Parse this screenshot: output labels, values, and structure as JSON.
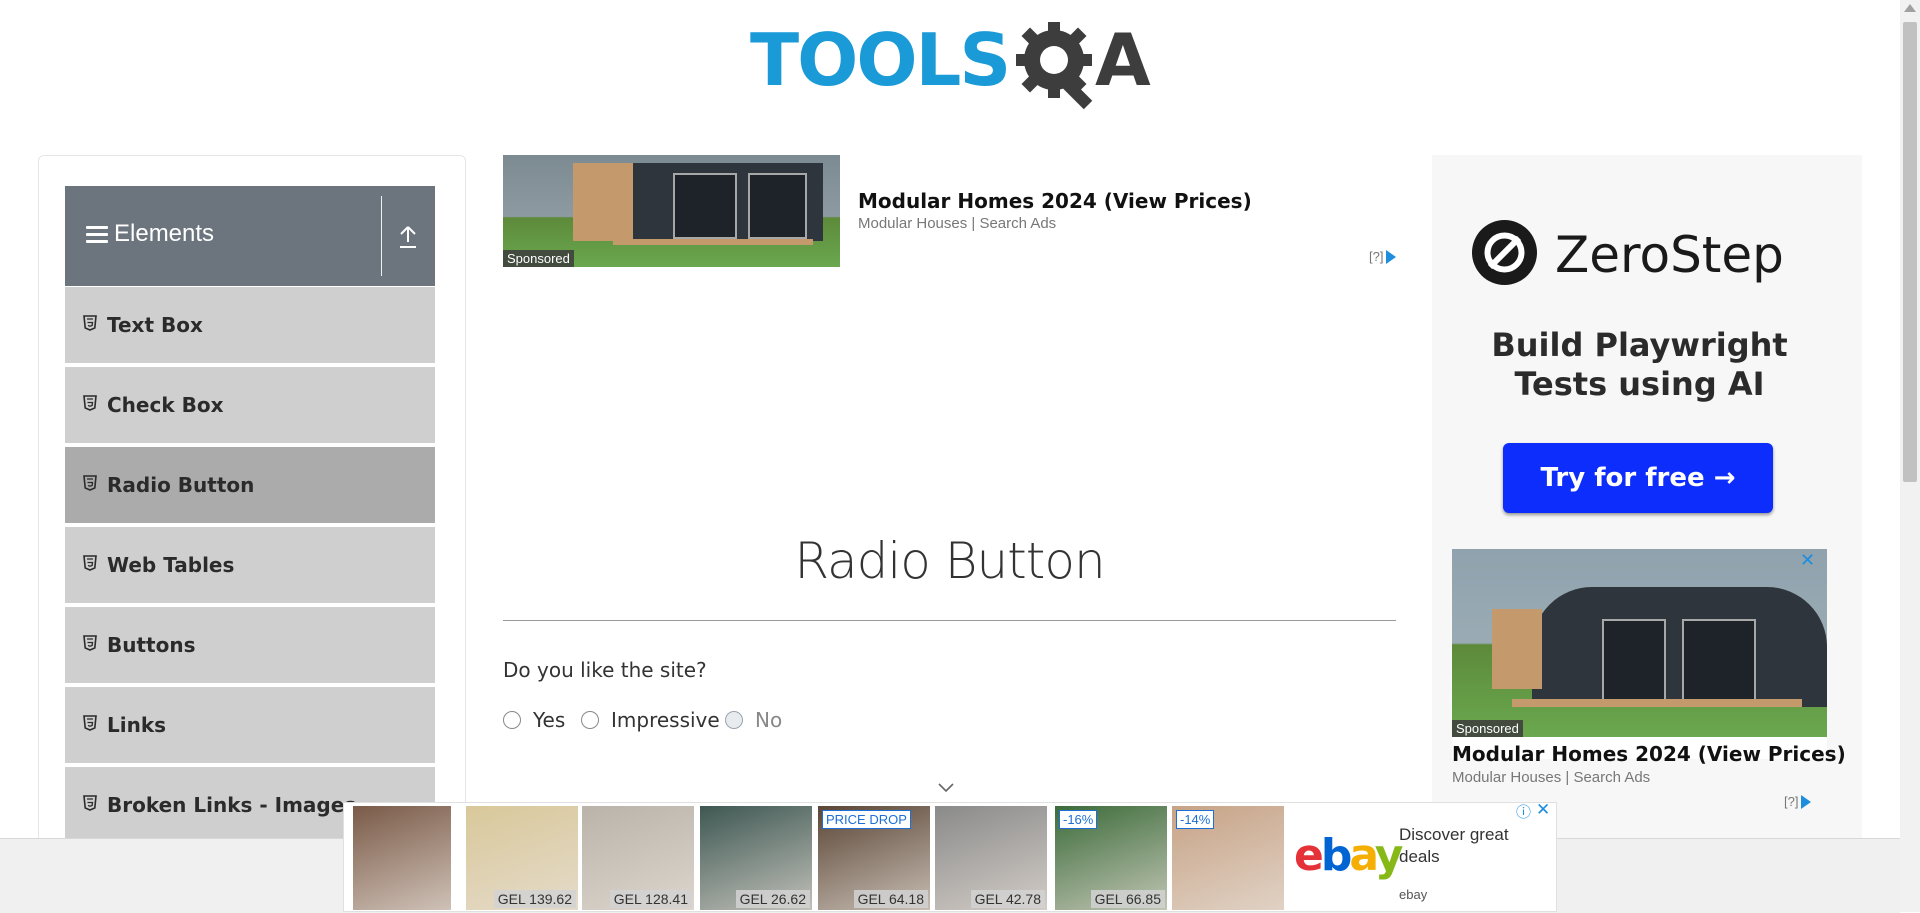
{
  "logo": {
    "part1": "TOOLS",
    "part2": "QA",
    "alt": "ToolsQA"
  },
  "sidebar": {
    "group_title": "Elements",
    "items": [
      {
        "label": "Text Box",
        "active": false
      },
      {
        "label": "Check Box",
        "active": false
      },
      {
        "label": "Radio Button",
        "active": true
      },
      {
        "label": "Web Tables",
        "active": false
      },
      {
        "label": "Buttons",
        "active": false
      },
      {
        "label": "Links",
        "active": false
      },
      {
        "label": "Broken Links - Images",
        "active": false
      }
    ]
  },
  "ad_top": {
    "sponsored": "Sponsored",
    "title": "Modular Homes 2024 (View Prices)",
    "source": "Modular Houses | Search Ads",
    "adchoice": "[?]"
  },
  "main": {
    "title": "Radio Button",
    "question": "Do you like the site?",
    "options": [
      {
        "label": "Yes",
        "disabled": false
      },
      {
        "label": "Impressive",
        "disabled": false
      },
      {
        "label": "No",
        "disabled": true
      }
    ]
  },
  "ad_right": {
    "brand": "ZeroStep",
    "headline": "Build Playwright Tests using AI",
    "cta": "Try for free →",
    "close": "✕",
    "sponsored": "Sponsored",
    "title": "Modular Homes 2024 (View Prices)",
    "source": "Modular Houses | Search Ads",
    "adchoice": "[?]"
  },
  "bottom_ad": {
    "tiles": [
      {
        "price": "",
        "badge": "",
        "bg": "#7a5a48"
      },
      {
        "price": "GEL 139.62",
        "badge": "",
        "bg": "#d9c89a"
      },
      {
        "price": "GEL 128.41",
        "badge": "",
        "bg": "#b9b3aa"
      },
      {
        "price": "GEL 26.62",
        "badge": "",
        "bg": "#3e5752"
      },
      {
        "price": "GEL 64.18",
        "badge": "PRICE DROP",
        "bg": "#5a4636"
      },
      {
        "price": "GEL 42.78",
        "badge": "",
        "bg": "#8a8a8a"
      },
      {
        "price": "GEL 66.85",
        "badge": "-16%",
        "bg": "#3c6b3a"
      },
      {
        "price": "",
        "badge": "-14%",
        "bg": "#c7a386"
      }
    ],
    "ebay_logo": "ebay",
    "ebay_text": "Discover great deals",
    "ebay_source": "ebay",
    "info": "ⓘ",
    "close": "✕"
  },
  "colors": {
    "accent": "#1a9ad6",
    "sidebar_header": "#6c757d",
    "menu_bg": "#cfcfcf",
    "menu_active": "#ababab",
    "cta": "#0d2dfc"
  }
}
